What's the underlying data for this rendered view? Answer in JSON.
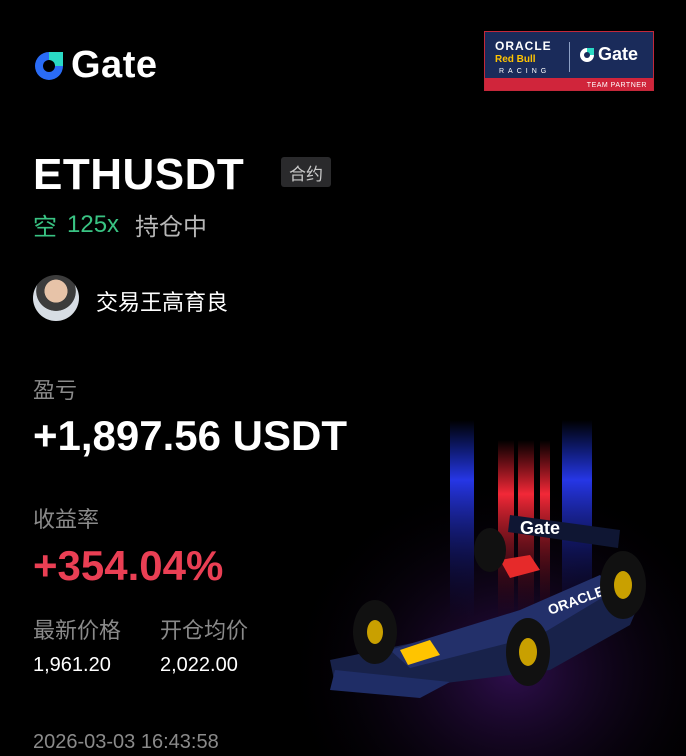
{
  "brand": {
    "name": "Gate"
  },
  "partner_badge": {
    "line1": "ORACLE",
    "line2": "Red Bull",
    "line3": "RACING",
    "brand": "Gate",
    "footer": "TEAM PARTNER"
  },
  "position": {
    "symbol": "ETHUSDT",
    "contract_tag": "合约",
    "side": "空",
    "leverage": "125x",
    "status": "持仓中"
  },
  "trader": {
    "name": "交易王高育良"
  },
  "metrics": {
    "pnl_label": "盈亏",
    "pnl_value": "+1,897.56 USDT",
    "roi_label": "收益率",
    "roi_value": "+354.04%",
    "last_price_label": "最新价格",
    "last_price": "1,961.20",
    "open_price_label": "开仓均价",
    "open_price": "2,022.00"
  },
  "timestamp": "2026-03-03 16:43:58",
  "colors": {
    "short": "#39c383",
    "roi": "#ea3f54",
    "brand_blue": "#2a6cf6"
  },
  "art": {
    "wing_text": "Gate",
    "sidepod_text": "ORACLE"
  }
}
